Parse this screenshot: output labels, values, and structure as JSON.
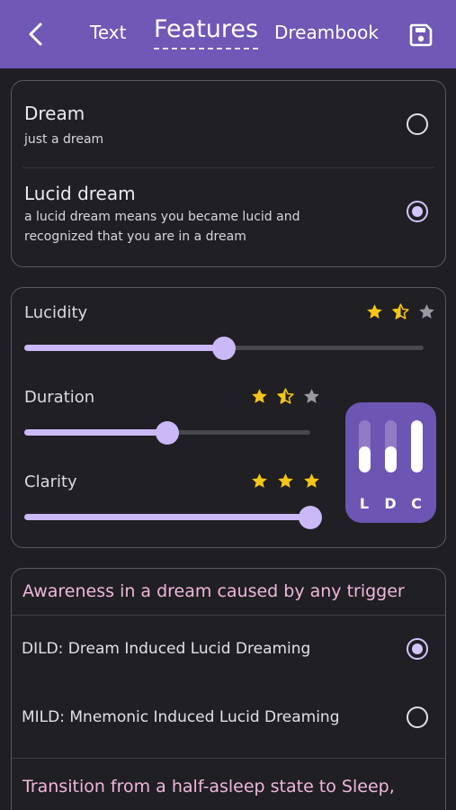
{
  "header": {
    "back_icon": "chevron-left-icon",
    "tabs": [
      {
        "label": "Text",
        "active": false
      },
      {
        "label": "Features",
        "active": true
      },
      {
        "label": "Dreambook",
        "active": false
      }
    ],
    "save_icon": "save-icon",
    "color": "#6f58b6"
  },
  "dream_type": {
    "options": [
      {
        "title": "Dream",
        "description": "just a dream",
        "selected": false
      },
      {
        "title": "Lucid dream",
        "description": "a lucid dream means you became lucid and recognized that you are in a dream",
        "selected": true
      }
    ]
  },
  "ratings": {
    "sliders": [
      {
        "label": "Lucidity",
        "value": 0.5,
        "stars": 1.5
      },
      {
        "label": "Duration",
        "value": 0.5,
        "stars": 1.5
      },
      {
        "label": "Clarity",
        "value": 1.0,
        "stars": 3
      }
    ],
    "summary_widget": {
      "labels": [
        "L",
        "D",
        "C"
      ],
      "levels": [
        0.5,
        0.5,
        1.0
      ]
    },
    "accent_color": "#cbb8f7",
    "star_color": "#f5c518"
  },
  "techniques": {
    "groups": [
      {
        "category": "Awareness in a dream caused by any trigger",
        "items": [
          {
            "label": "DILD: Dream Induced Lucid Dreaming",
            "selected": true
          },
          {
            "label": "MILD: Mnemonic Induced Lucid Dreaming",
            "selected": false
          }
        ]
      },
      {
        "category": "Transition from a half-asleep state to Sleep,",
        "items": []
      }
    ]
  }
}
